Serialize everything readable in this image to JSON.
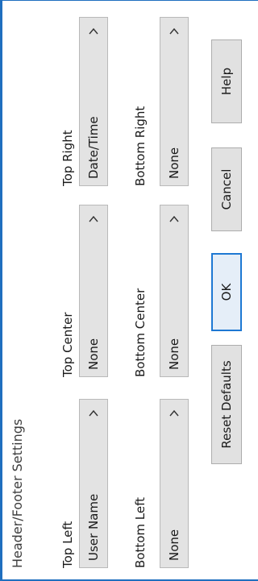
{
  "dialog": {
    "title": "Header/Footer Settings"
  },
  "fields": {
    "top_left": {
      "label": "Top Left",
      "value": "User Name"
    },
    "top_center": {
      "label": "Top Center",
      "value": "None"
    },
    "top_right": {
      "label": "Top Right",
      "value": "Date/Time"
    },
    "bottom_left": {
      "label": "Bottom Left",
      "value": "None"
    },
    "bottom_center": {
      "label": "Bottom Center",
      "value": "None"
    },
    "bottom_right": {
      "label": "Bottom Right",
      "value": "None"
    }
  },
  "buttons": {
    "reset": "Reset Defaults",
    "ok": "OK",
    "cancel": "Cancel",
    "help": "Help"
  },
  "icons": {
    "dropdown": "chevron-right-icon"
  },
  "colors": {
    "accent": "#1e78d3",
    "frame": "#1f6fbf",
    "control_bg": "#e3e3e3"
  }
}
